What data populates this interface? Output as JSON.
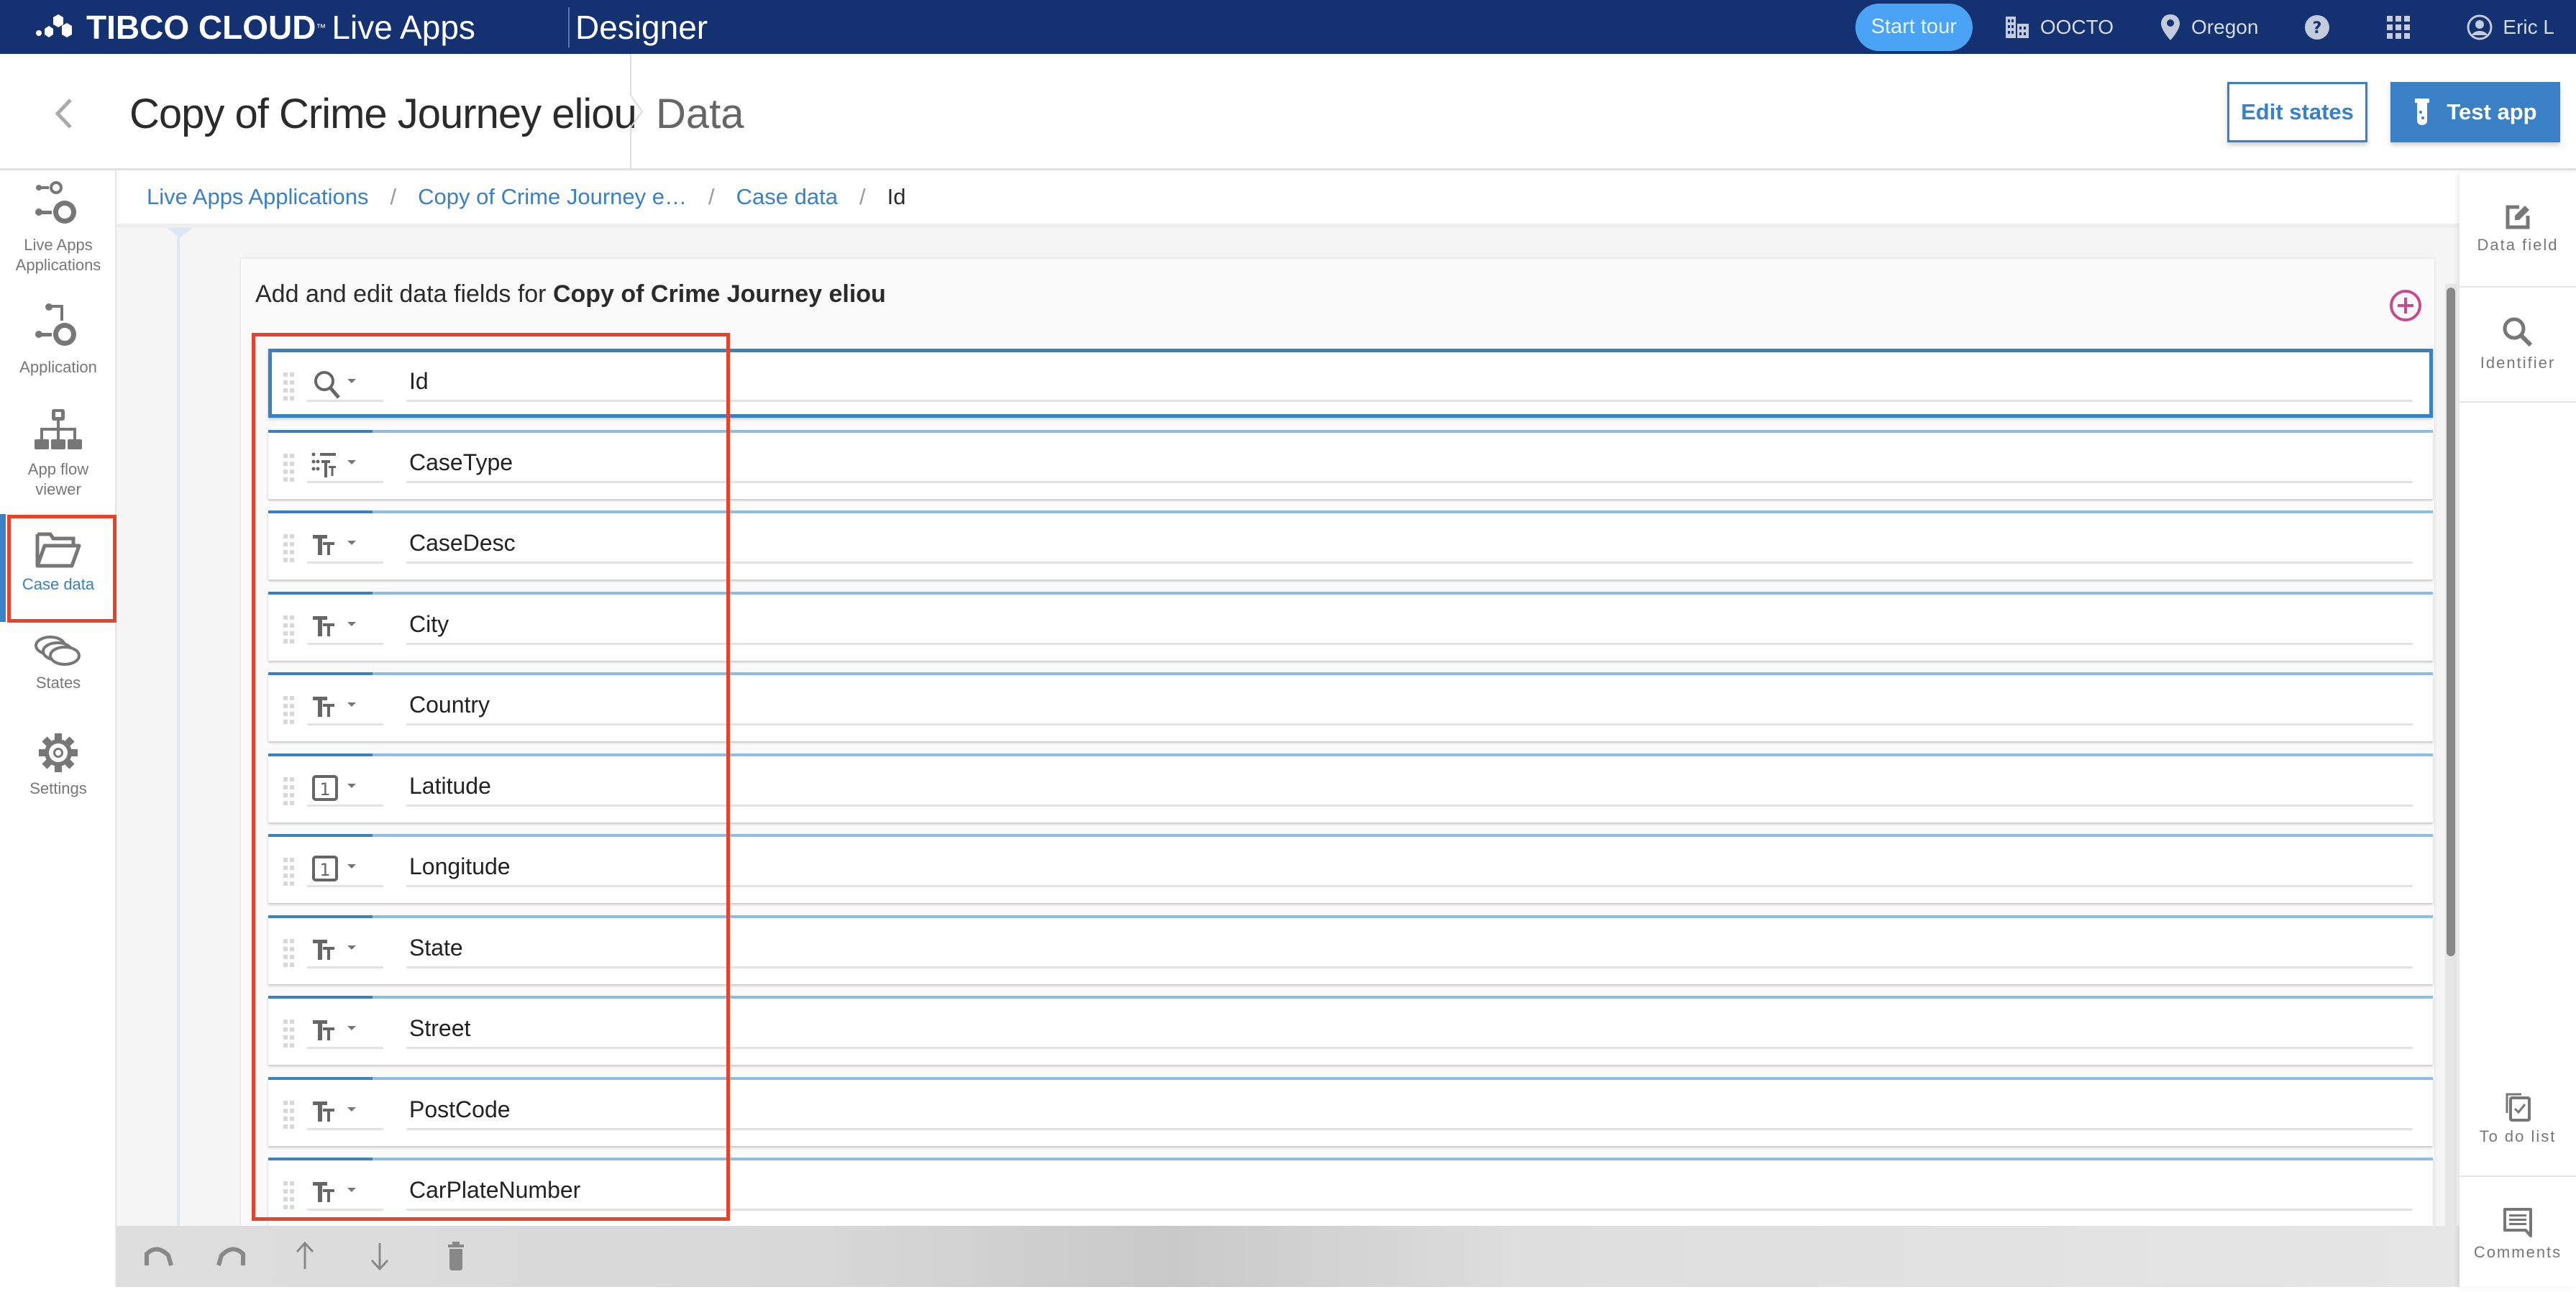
{
  "topbar": {
    "brand_name": "TIBCO CLOUD",
    "brand_product": "Live Apps",
    "section": "Designer",
    "start_tour": "Start tour",
    "org": "OOCTO",
    "region": "Oregon",
    "user": "Eric L"
  },
  "header": {
    "title": "Copy of Crime Journey eliou",
    "subtitle": "Data",
    "edit_states": "Edit states",
    "test_app": "Test app"
  },
  "leftnav": {
    "items": [
      {
        "label_1": "Live Apps",
        "label_2": "Applications",
        "icon": "app-gears-icon"
      },
      {
        "label_1": "Application",
        "icon": "application-icon"
      },
      {
        "label_1": "App flow",
        "label_2": "viewer",
        "icon": "flow-chart-icon"
      },
      {
        "label_1": "Case data",
        "icon": "folder-open-icon",
        "active": true
      },
      {
        "label_1": "States",
        "icon": "states-icon"
      },
      {
        "label_1": "Settings",
        "icon": "gear-icon"
      }
    ]
  },
  "breadcrumb": {
    "items": [
      "Live Apps Applications",
      "Copy of Crime Journey e…",
      "Case data",
      "Id"
    ],
    "separator": "/"
  },
  "card": {
    "title_prefix": "Add and edit data fields for ",
    "title_app": "Copy of Crime Journey eliou"
  },
  "fields": [
    {
      "name": "Id",
      "type": "identifier",
      "selected": true
    },
    {
      "name": "CaseType",
      "type": "list-text"
    },
    {
      "name": "CaseDesc",
      "type": "text"
    },
    {
      "name": "City",
      "type": "text"
    },
    {
      "name": "Country",
      "type": "text"
    },
    {
      "name": "Latitude",
      "type": "number"
    },
    {
      "name": "Longitude",
      "type": "number"
    },
    {
      "name": "State",
      "type": "text"
    },
    {
      "name": "Street",
      "type": "text"
    },
    {
      "name": "PostCode",
      "type": "text"
    },
    {
      "name": "CarPlateNumber",
      "type": "text"
    }
  ],
  "rightpanel": {
    "data_field": "Data field",
    "identifier": "Identifier",
    "todo": "To do list",
    "comments": "Comments"
  },
  "colors": {
    "topbar": "#143172",
    "accent": "#3a80c4",
    "start_tour": "#4aa3f4",
    "add": "#c94a8c",
    "highlight": "#e4432d"
  }
}
